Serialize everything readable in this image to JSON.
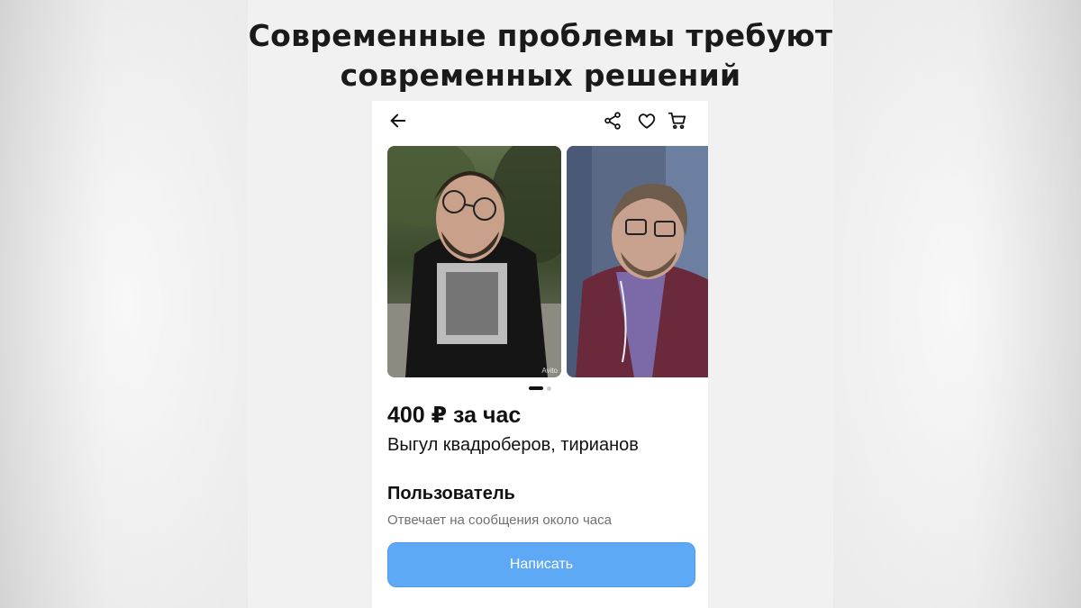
{
  "meme": {
    "caption_line1": "Современные проблемы требуют",
    "caption_line2": "современных решений"
  },
  "topbar": {
    "icons": [
      "back-arrow-icon",
      "share-icon",
      "heart-icon",
      "cart-icon"
    ]
  },
  "gallery": {
    "watermark": "Avito",
    "slide_count": 2,
    "active_slide": 1
  },
  "listing": {
    "price": "400 ₽ за час",
    "title": "Выгул квадроберов, тирианов"
  },
  "seller": {
    "name": "Пользователь",
    "status": "Отвечает на сообщения около часа"
  },
  "actions": {
    "write_label": "Написать"
  },
  "colors": {
    "primary_button": "#5ea9f5",
    "text": "#111111",
    "muted_text": "#6f6f6f"
  }
}
